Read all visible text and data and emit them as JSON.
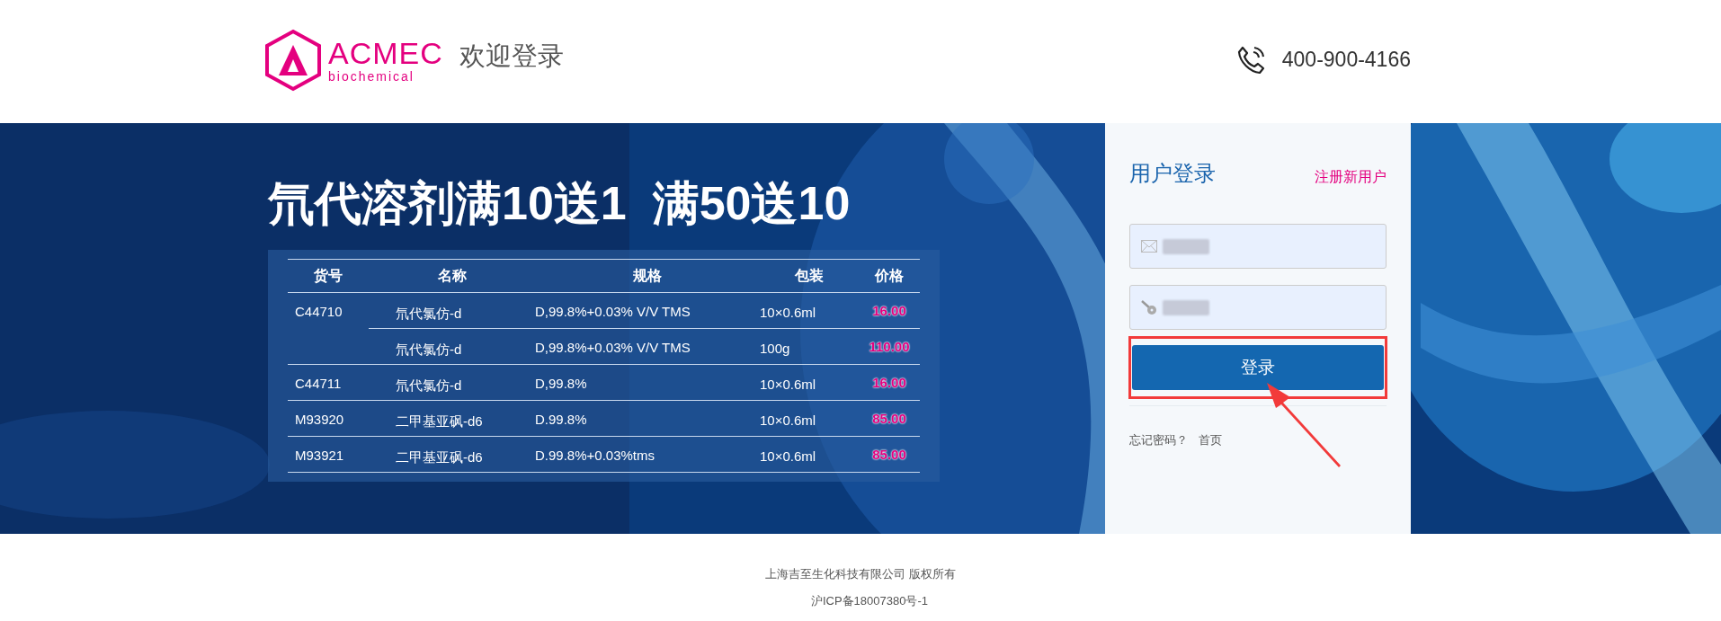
{
  "header": {
    "brand": "ACMEC",
    "brand_sub": "biochemical",
    "title": "欢迎登录",
    "phone": "400-900-4166"
  },
  "banner": {
    "headline": "氘代溶剂满10送1  满50送10",
    "table": {
      "columns": [
        "货号",
        "名称",
        "规格",
        "包装",
        "价格"
      ],
      "rows": [
        {
          "code": "C44710",
          "name": "氘代氯仿-d",
          "spec": "D,99.8%+0.03% V/V TMS",
          "pack": "10×0.6ml",
          "price": "16.00"
        },
        {
          "name": "氘代氯仿-d",
          "spec": "D,99.8%+0.03% V/V TMS",
          "pack": "100g",
          "price": "110.00"
        },
        {
          "code": "C44711",
          "name": "氘代氯仿-d",
          "spec": "D,99.8%",
          "pack": "10×0.6ml",
          "price": "16.00"
        },
        {
          "code": "M93920",
          "name": "二甲基亚砜-d6",
          "spec": "D.99.8%",
          "pack": "10×0.6ml",
          "price": "85.00"
        },
        {
          "code": "M93921",
          "name": "二甲基亚砜-d6",
          "spec": "D.99.8%+0.03%tms",
          "pack": "10×0.6ml",
          "price": "85.00"
        }
      ]
    }
  },
  "login": {
    "title": "用户登录",
    "register": "注册新用户",
    "fields": [
      {
        "kind": "email"
      },
      {
        "kind": "password"
      }
    ],
    "button": "登录",
    "links": [
      "忘记密码？",
      "首页"
    ]
  },
  "footer": {
    "copyright": "上海吉至生化科技有限公司 版权所有",
    "icp": "沪ICP备18007380号-1"
  }
}
